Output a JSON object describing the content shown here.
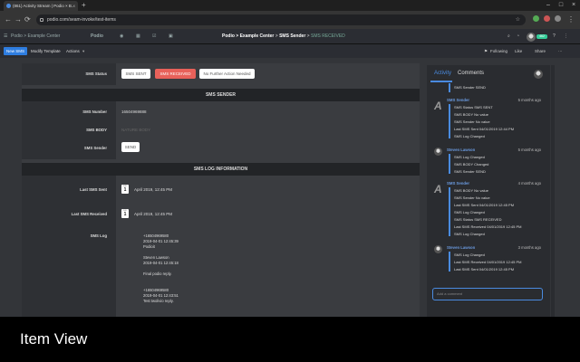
{
  "browser": {
    "tab_title": "(861) Activity Stream | Podio × B...",
    "tab_close": "×",
    "new_tab": "+",
    "url": "podio.com/seam-invoke/test-items",
    "window_controls": [
      "–",
      "□",
      "×"
    ]
  },
  "appnav": {
    "workspace": "Podio > Example Center",
    "logo": "Podio",
    "breadcrumb_app": "Podio > Example Center",
    "breadcrumb_sep1": ">",
    "breadcrumb_item": "SMS Sender",
    "breadcrumb_sep2": ">",
    "breadcrumb_current": "SMS RECEIVED",
    "badge": "462"
  },
  "toolbar": {
    "new_label": "New SMS",
    "modify_label": "Modify Template",
    "actions_label": "Actions",
    "following_label": "Following",
    "like_label": "Like",
    "share_label": "Share"
  },
  "fields": {
    "sms_status_label": "SMS Status",
    "status_options": [
      "SMS SENT",
      "SMS RECEIVED",
      "No Further Action Needed"
    ],
    "status_colors": {
      "active": "#e8615a"
    },
    "sms_sender_header": "SMS SENDER",
    "sms_number_label": "SMS Number",
    "sms_number_value": "16504969888",
    "sms_body_label": "SMS BODY",
    "sms_body_value": "NATURE BODY",
    "sms_sender_label": "SMS Sender",
    "send_label": "SEND",
    "log_header": "SMS LOG INFORMATION",
    "last_sent_label": "Last SMS Sent",
    "last_sent_month": "Apr",
    "last_sent_day": "1",
    "last_sent_value": "April 2019, 12:45 PM",
    "last_received_label": "Last SMS Received",
    "last_received_month": "Apr",
    "last_received_day": "1",
    "last_received_value": "April 2019, 12:45 PM",
    "sms_log_label": "SMS Log",
    "sms_log_text": "+16504969580\n2019-04-01 12:45:39\nPodioit\n\nSteven Lawson\n2019-04-01 12:45:18\n\nFinal podio reply.\n\n\n+16504969580\n2019-04-01 12:43:51\nTest twolivio reply."
  },
  "activity": {
    "tab_activity": "Activity",
    "tab_comments": "Comments",
    "items": [
      {
        "name": "SMS Sender",
        "time": "5 months ago",
        "changes": [
          "SMS Status SMS SENT",
          "SMS BODY No value",
          "SMS Sender No value",
          "Last SMS Sent 04/01/2019 12:44 PM",
          "SMS Log Changed"
        ]
      },
      {
        "name": "Steven Lawson",
        "time": "5 months ago",
        "changes": [
          "SMS Log Changed",
          "SMS BODY Changed",
          "SMS Sender SEND"
        ]
      },
      {
        "name": "SMS Sender",
        "time": "4 months ago",
        "changes": [
          "SMS BODY No value",
          "SMS Sender No value",
          "Last SMS Sent 04/01/2019 12:45 PM",
          "SMS Log Changed",
          "SMS Status SMS RECEIVED",
          "Last SMS Received 04/01/2019 12:45 PM",
          "SMS Log Changed"
        ]
      },
      {
        "name": "Steven Lawson",
        "time": "3 months ago",
        "changes": [
          "SMS Log Changed",
          "Last SMS Received 04/01/2019 12:45 PM",
          "Last SMS Sent 04/01/2019 12:45 PM"
        ]
      }
    ],
    "top_change": "SMS Sender SEND",
    "comment_placeholder": "Add a comment"
  },
  "caption": "Item View"
}
